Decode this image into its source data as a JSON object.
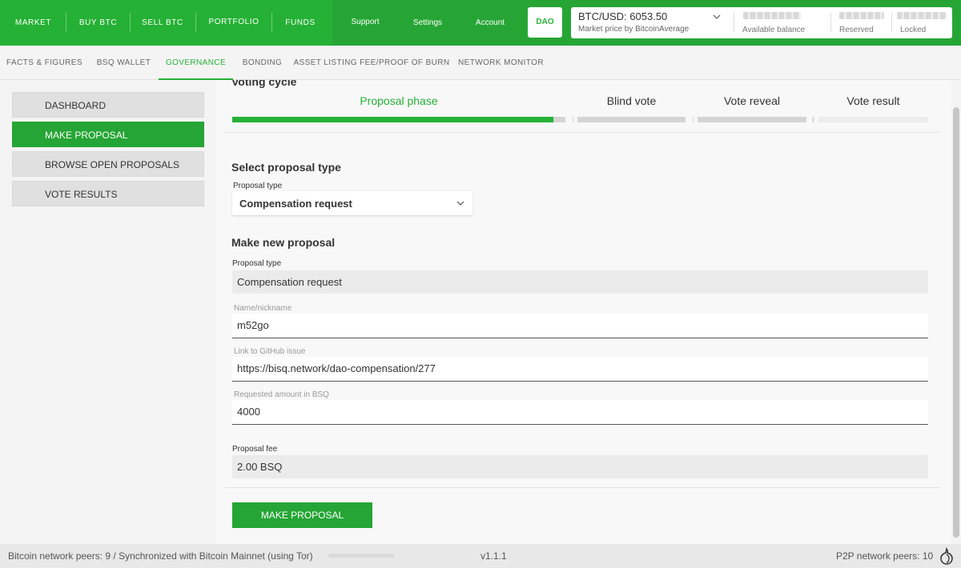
{
  "topnav": {
    "items": [
      "MARKET",
      "BUY BTC",
      "SELL BTC",
      "PORTFOLIO",
      "FUNDS"
    ],
    "secondary": [
      "Support",
      "Settings",
      "Account"
    ],
    "dao_label": "DAO"
  },
  "price": {
    "label": "BTC/USD: 6053.50",
    "subtitle": "Market price by BitcoinAverage"
  },
  "balances": {
    "available_label": "Available balance",
    "reserved_label": "Reserved",
    "locked_label": "Locked"
  },
  "subnav": {
    "items": [
      "FACTS & FIGURES",
      "BSQ WALLET",
      "GOVERNANCE",
      "BONDING",
      "ASSET LISTING FEE/PROOF OF BURN",
      "NETWORK MONITOR"
    ],
    "active": "GOVERNANCE"
  },
  "sidebar": {
    "items": [
      "DASHBOARD",
      "MAKE PROPOSAL",
      "BROWSE OPEN PROPOSALS",
      "VOTE RESULTS"
    ],
    "active": "MAKE PROPOSAL"
  },
  "cycle": {
    "title": "Voting cycle",
    "phases": [
      "Proposal phase",
      "Blind vote",
      "Vote reveal",
      "Vote result"
    ],
    "active_phase": "Proposal phase",
    "proposal_progress": 0.965
  },
  "select_section": {
    "title": "Select proposal type",
    "label": "Proposal type",
    "value": "Compensation request"
  },
  "new_proposal": {
    "title": "Make new proposal",
    "type_label": "Proposal type",
    "type_value": "Compensation request",
    "name_label": "Name/nickname",
    "name_value": "m52go",
    "link_label": "Link to GitHub issue",
    "link_value": "https://bisq.network/dao-compensation/277",
    "amount_label": "Requested amount in BSQ",
    "amount_value": "4000",
    "fee_label": "Proposal fee",
    "fee_value": "2.00 BSQ",
    "submit_label": "MAKE PROPOSAL"
  },
  "footer": {
    "left": "Bitcoin network peers: 9 / Synchronized with Bitcoin Mainnet (using Tor)",
    "version": "v1.1.1",
    "right": "P2P network peers: 10"
  },
  "colors": {
    "accent": "#25b135",
    "accent_dark": "#25a535"
  }
}
